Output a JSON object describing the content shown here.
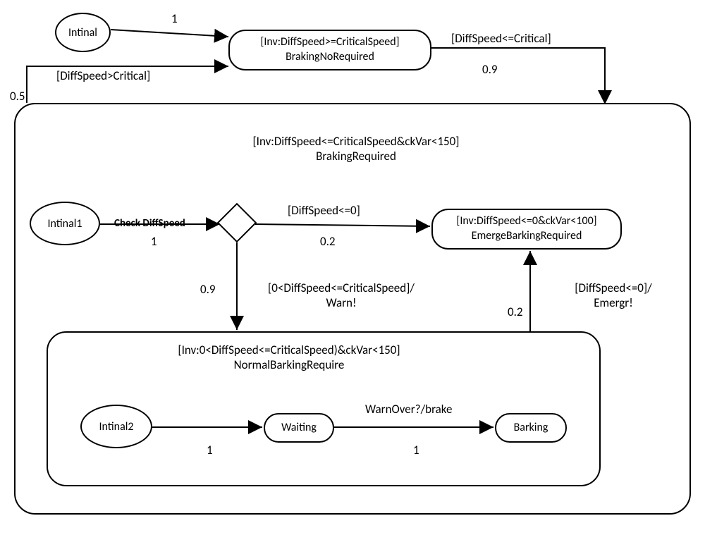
{
  "nodes": {
    "initial": "Intinal",
    "brakingNoRequired_inv": "[Inv:DiffSpeed>=CriticalSpeed]",
    "brakingNoRequired": "BrakingNoRequired",
    "brakingRequired_inv": "[Inv:DiffSpeed<=CriticalSpeed&ckVar<150]",
    "brakingRequired": "BrakingRequired",
    "initial1": "Intinal1",
    "emerge_inv": "[Inv:DiffSpeed<=0&ckVar<100]",
    "emerge": "EmergeBarkingRequired",
    "normal_inv": "[Inv:0<DiffSpeed<=CriticalSpeed)&ckVar<150]",
    "normal": "NormalBarkingRequire",
    "initial2": "Intinal2",
    "waiting": "Waiting",
    "barking": "Barking"
  },
  "edges": {
    "e_init_bnr_prob": "1",
    "e_br_bnr_guard": "[DiffSpeed>Critical]",
    "e_br_bnr_prob": "0.5",
    "e_bnr_br_guard": "[DiffSpeed<=Critical]",
    "e_bnr_br_prob": "0.9",
    "e_init1_check": "Check DiffSpeed",
    "e_init1_prob": "1",
    "e_diamond_emerge_guard": "[DiffSpeed<=0]",
    "e_diamond_emerge_prob": "0.2",
    "e_diamond_normal_guard": "[0<DiffSpeed<=CriticalSpeed]/\nWarn!",
    "e_diamond_normal_prob": "0.9",
    "e_normal_emerge_guard": "[DiffSpeed<=0]/\nEmergr!",
    "e_normal_emerge_prob": "0.2",
    "e_init2_wait_prob": "1",
    "e_wait_bark_guard": "WarnOver?/brake",
    "e_wait_bark_prob": "1"
  },
  "chart_data": {
    "type": "state-machine",
    "states": [
      {
        "id": "Intinal",
        "kind": "initial"
      },
      {
        "id": "BrakingNoRequired",
        "inv": "DiffSpeed>=CriticalSpeed"
      },
      {
        "id": "BrakingRequired",
        "inv": "DiffSpeed<=CriticalSpeed & ckVar<150",
        "composite": true,
        "sub": [
          {
            "id": "Intinal1",
            "kind": "initial"
          },
          {
            "id": "decision",
            "kind": "choice"
          },
          {
            "id": "EmergeBarkingRequired",
            "inv": "DiffSpeed<=0 & ckVar<100"
          },
          {
            "id": "NormalBarkingRequire",
            "inv": "0<DiffSpeed<=CriticalSpeed & ckVar<150",
            "composite": true,
            "sub": [
              {
                "id": "Intinal2",
                "kind": "initial"
              },
              {
                "id": "Waiting"
              },
              {
                "id": "Barking"
              }
            ]
          }
        ]
      }
    ],
    "transitions": [
      {
        "from": "Intinal",
        "to": "BrakingNoRequired",
        "prob": 1
      },
      {
        "from": "BrakingRequired",
        "to": "BrakingNoRequired",
        "guard": "DiffSpeed>Critical",
        "prob": 0.5
      },
      {
        "from": "BrakingNoRequired",
        "to": "BrakingRequired",
        "guard": "DiffSpeed<=Critical",
        "prob": 0.9
      },
      {
        "from": "Intinal1",
        "to": "decision",
        "label": "Check DiffSpeed",
        "prob": 1
      },
      {
        "from": "decision",
        "to": "EmergeBarkingRequired",
        "guard": "DiffSpeed<=0",
        "prob": 0.2
      },
      {
        "from": "decision",
        "to": "NormalBarkingRequire",
        "guard": "0<DiffSpeed<=CriticalSpeed",
        "action": "Warn!",
        "prob": 0.9
      },
      {
        "from": "NormalBarkingRequire",
        "to": "EmergeBarkingRequired",
        "guard": "DiffSpeed<=0",
        "action": "Emergr!",
        "prob": 0.2
      },
      {
        "from": "Intinal2",
        "to": "Waiting",
        "prob": 1
      },
      {
        "from": "Waiting",
        "to": "Barking",
        "guard": "WarnOver?",
        "action": "brake",
        "prob": 1
      }
    ]
  }
}
